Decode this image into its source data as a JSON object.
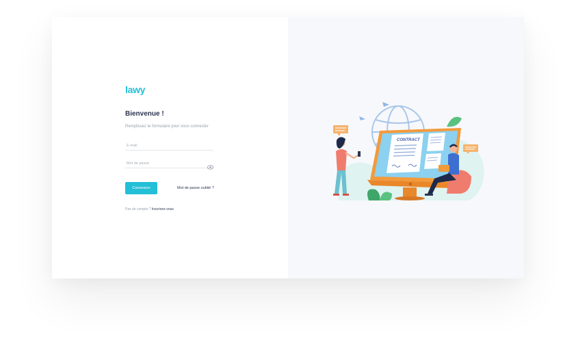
{
  "brand": {
    "name": "lawy",
    "accent": "#23bfd6"
  },
  "login": {
    "title": "Bienvenue !",
    "subtitle": "Remplissez le formulaire pour vous connecter",
    "email_placeholder": "E-mail",
    "password_placeholder": "Mot de passe",
    "submit_label": "Connexion",
    "forgot_label": "Mot de passe oublié ?",
    "no_account_text": "Pas de compte ?",
    "signup_label": "Inscrivez-vous"
  },
  "illustration": {
    "contract_title": "CONTRACT"
  }
}
